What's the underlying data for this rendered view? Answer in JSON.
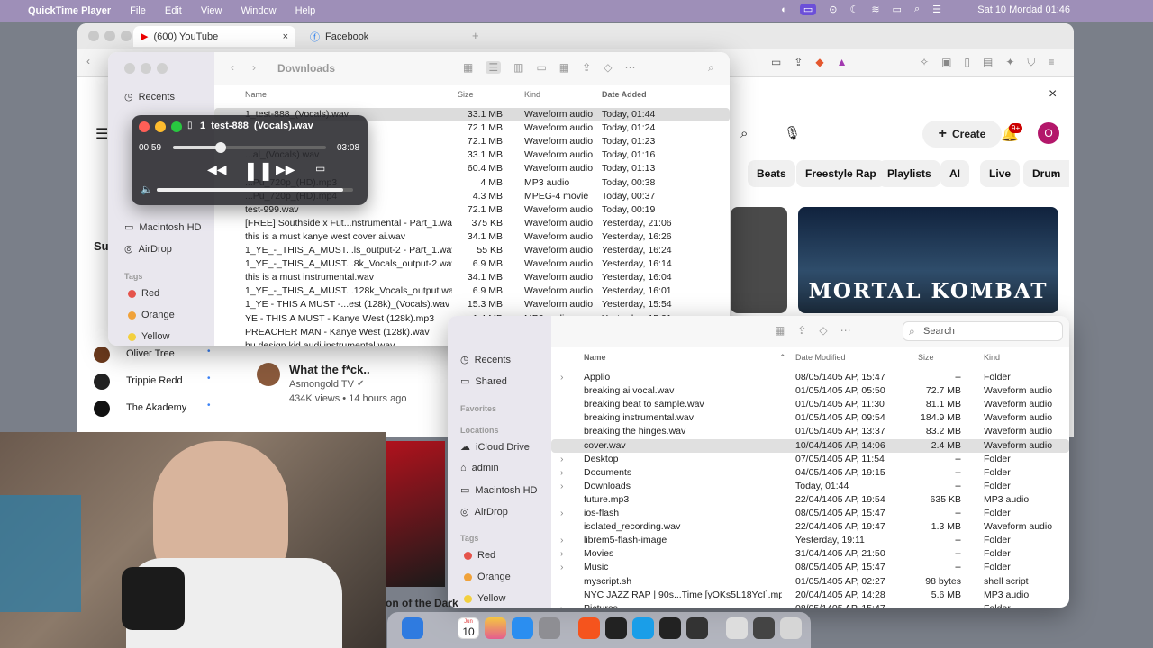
{
  "menubar": {
    "apple": "",
    "app": "QuickTime Player",
    "items": [
      "File",
      "Edit",
      "View",
      "Window",
      "Help"
    ],
    "clock": "Sat 10 Mordad  01:46"
  },
  "browser": {
    "tabs": [
      {
        "label": "(600) YouTube",
        "close": "×"
      },
      {
        "label": "Facebook"
      }
    ],
    "new_tab": "+"
  },
  "youtube": {
    "create": "Create",
    "notif_badge": "9+",
    "avatar": "O",
    "close": "×",
    "chips": [
      "Beats",
      "Freestyle Rap",
      "Playlists",
      "AI",
      "Live",
      "Drum"
    ],
    "subs_heading": "Su",
    "channels": [
      {
        "name": "Oliver Tree"
      },
      {
        "name": "Trippie Redd"
      },
      {
        "name": "The Akademy"
      }
    ],
    "video": {
      "title": "What the f*ck..",
      "channel": "Asmongold TV",
      "meta": "434K views • 14 hours ago"
    },
    "thumb_text": "MORTAL KOMBAT",
    "partial_title": "on of the Dark"
  },
  "player": {
    "title": "1_test-888_(Vocals).wav",
    "elapsed": "00:59",
    "duration": "03:08",
    "progress": 0.31,
    "volume": 0.95
  },
  "finder1": {
    "title": "Downloads",
    "sidebar": {
      "recents": "Recents",
      "macintosh": "Macintosh HD",
      "airdrop": "AirDrop",
      "tags_head": "Tags",
      "tags": [
        "Red",
        "Orange",
        "Yellow"
      ]
    },
    "cols": {
      "name": "Name",
      "size": "Size",
      "kind": "Kind",
      "date": "Date Added"
    },
    "rows": [
      {
        "name": "1_test-888_(Vocals).wav",
        "size": "33.1 MB",
        "kind": "Waveform audio",
        "date": "Today, 01:44"
      },
      {
        "name": "",
        "size": "72.1 MB",
        "kind": "Waveform audio",
        "date": "Today, 01:24"
      },
      {
        "name": "",
        "size": "72.1 MB",
        "kind": "Waveform audio",
        "date": "Today, 01:23"
      },
      {
        "name": "...al_(Vocals).wav",
        "size": "33.1 MB",
        "kind": "Waveform audio",
        "date": "Today, 01:16"
      },
      {
        "name": "",
        "size": "60.4 MB",
        "kind": "Waveform audio",
        "date": "Today, 01:13"
      },
      {
        "name": "...Pu_720p_(HD).mp3",
        "size": "4 MB",
        "kind": "MP3 audio",
        "date": "Today, 00:38"
      },
      {
        "name": "...Pu_720p_(HD).mp4",
        "size": "4.3 MB",
        "kind": "MPEG-4 movie",
        "date": "Today, 00:37"
      },
      {
        "name": "test-999.wav",
        "size": "72.1 MB",
        "kind": "Waveform audio",
        "date": "Today, 00:19"
      },
      {
        "name": "[FREE] Southside x Fut...nstrumental - Part_1.wav",
        "size": "375 KB",
        "kind": "Waveform audio",
        "date": "Yesterday, 21:06"
      },
      {
        "name": "this is a must kanye west cover ai.wav",
        "size": "34.1 MB",
        "kind": "Waveform audio",
        "date": "Yesterday, 16:26"
      },
      {
        "name": "1_YE_-_THIS_A_MUST...ls_output-2 - Part_1.wav",
        "size": "55 KB",
        "kind": "Waveform audio",
        "date": "Yesterday, 16:24"
      },
      {
        "name": "1_YE_-_THIS_A_MUST...8k_Vocals_output-2.wav",
        "size": "6.9 MB",
        "kind": "Waveform audio",
        "date": "Yesterday, 16:14"
      },
      {
        "name": "this is a must instrumental.wav",
        "size": "34.1 MB",
        "kind": "Waveform audio",
        "date": "Yesterday, 16:04"
      },
      {
        "name": "1_YE_-_THIS_A_MUST...128k_Vocals_output.wav",
        "size": "6.9 MB",
        "kind": "Waveform audio",
        "date": "Yesterday, 16:01"
      },
      {
        "name": "1_YE - THIS A MUST -...est (128k)_(Vocals).wav",
        "size": "15.3 MB",
        "kind": "Waveform audio",
        "date": "Yesterday, 15:54"
      },
      {
        "name": "YE - THIS A MUST - Kanye West (128k).mp3",
        "size": "1.4 MB",
        "kind": "MP3 audio",
        "date": "Yesterday, 15:31"
      },
      {
        "name": "PREACHER MAN - Kanye West (128k).wav",
        "size": "32 MB",
        "kind": "Waveform audio",
        "date": "Yesterday, 15:15"
      },
      {
        "name": "hu design kid audi instrumental.wav",
        "size": "99.5 MB",
        "kind": "Waveform audio",
        "date": "Yesterday, 13:46"
      }
    ]
  },
  "finder2": {
    "search": "Search",
    "sidebar": {
      "recents": "Recents",
      "shared": "Shared",
      "fav_head": "Favorites",
      "loc_head": "Locations",
      "icloud": "iCloud Drive",
      "admin": "admin",
      "macintosh": "Macintosh HD",
      "airdrop": "AirDrop",
      "tags_head": "Tags",
      "tags": [
        "Red",
        "Orange",
        "Yellow"
      ]
    },
    "cols": {
      "name": "Name",
      "date": "Date Modified",
      "size": "Size",
      "kind": "Kind"
    },
    "rows": [
      {
        "name": "Applio",
        "date": "08/05/1405 AP, 15:47",
        "size": "--",
        "kind": "Folder",
        "folder": true
      },
      {
        "name": "breaking ai vocal.wav",
        "date": "01/05/1405 AP, 05:50",
        "size": "72.7 MB",
        "kind": "Waveform audio"
      },
      {
        "name": "breaking beat to sample.wav",
        "date": "01/05/1405 AP, 11:30",
        "size": "81.1 MB",
        "kind": "Waveform audio"
      },
      {
        "name": "breaking instrumental.wav",
        "date": "01/05/1405 AP, 09:54",
        "size": "184.9 MB",
        "kind": "Waveform audio"
      },
      {
        "name": "breaking the hinges.wav",
        "date": "01/05/1405 AP, 13:37",
        "size": "83.2 MB",
        "kind": "Waveform audio"
      },
      {
        "name": "cover.wav",
        "date": "10/04/1405 AP, 14:06",
        "size": "2.4 MB",
        "kind": "Waveform audio"
      },
      {
        "name": "Desktop",
        "date": "07/05/1405 AP, 11:54",
        "size": "--",
        "kind": "Folder",
        "folder": true
      },
      {
        "name": "Documents",
        "date": "04/05/1405 AP, 19:15",
        "size": "--",
        "kind": "Folder",
        "folder": true
      },
      {
        "name": "Downloads",
        "date": "Today, 01:44",
        "size": "--",
        "kind": "Folder",
        "folder": true
      },
      {
        "name": "future.mp3",
        "date": "22/04/1405 AP, 19:54",
        "size": "635 KB",
        "kind": "MP3 audio"
      },
      {
        "name": "ios-flash",
        "date": "08/05/1405 AP, 15:47",
        "size": "--",
        "kind": "Folder",
        "folder": true
      },
      {
        "name": "isolated_recording.wav",
        "date": "22/04/1405 AP, 19:47",
        "size": "1.3 MB",
        "kind": "Waveform audio"
      },
      {
        "name": "librem5-flash-image",
        "date": "Yesterday, 19:11",
        "size": "--",
        "kind": "Folder",
        "folder": true
      },
      {
        "name": "Movies",
        "date": "31/04/1405 AP, 21:50",
        "size": "--",
        "kind": "Folder",
        "folder": true
      },
      {
        "name": "Music",
        "date": "08/05/1405 AP, 15:47",
        "size": "--",
        "kind": "Folder",
        "folder": true
      },
      {
        "name": "myscript.sh",
        "date": "01/05/1405 AP, 02:27",
        "size": "98 bytes",
        "kind": "shell script"
      },
      {
        "name": "NYC JAZZ RAP  |  90s...Time [yOKs5L18YcI].mp3",
        "date": "20/04/1405 AP, 14:28",
        "size": "5.6 MB",
        "kind": "MP3 audio"
      },
      {
        "name": "Pictures",
        "date": "08/05/1405 AP, 15:47",
        "size": "--",
        "kind": "Folder",
        "folder": true
      }
    ]
  },
  "dock": {
    "calendar_month": "Jun",
    "calendar_day": "10"
  },
  "colors": {
    "accent": "#3b82f6",
    "tagRed": "#e5534b",
    "tagOrange": "#f0a23a",
    "tagYellow": "#f3d03e",
    "folder": "#5aa9f0",
    "purple_bar": "#9e8fb8"
  }
}
